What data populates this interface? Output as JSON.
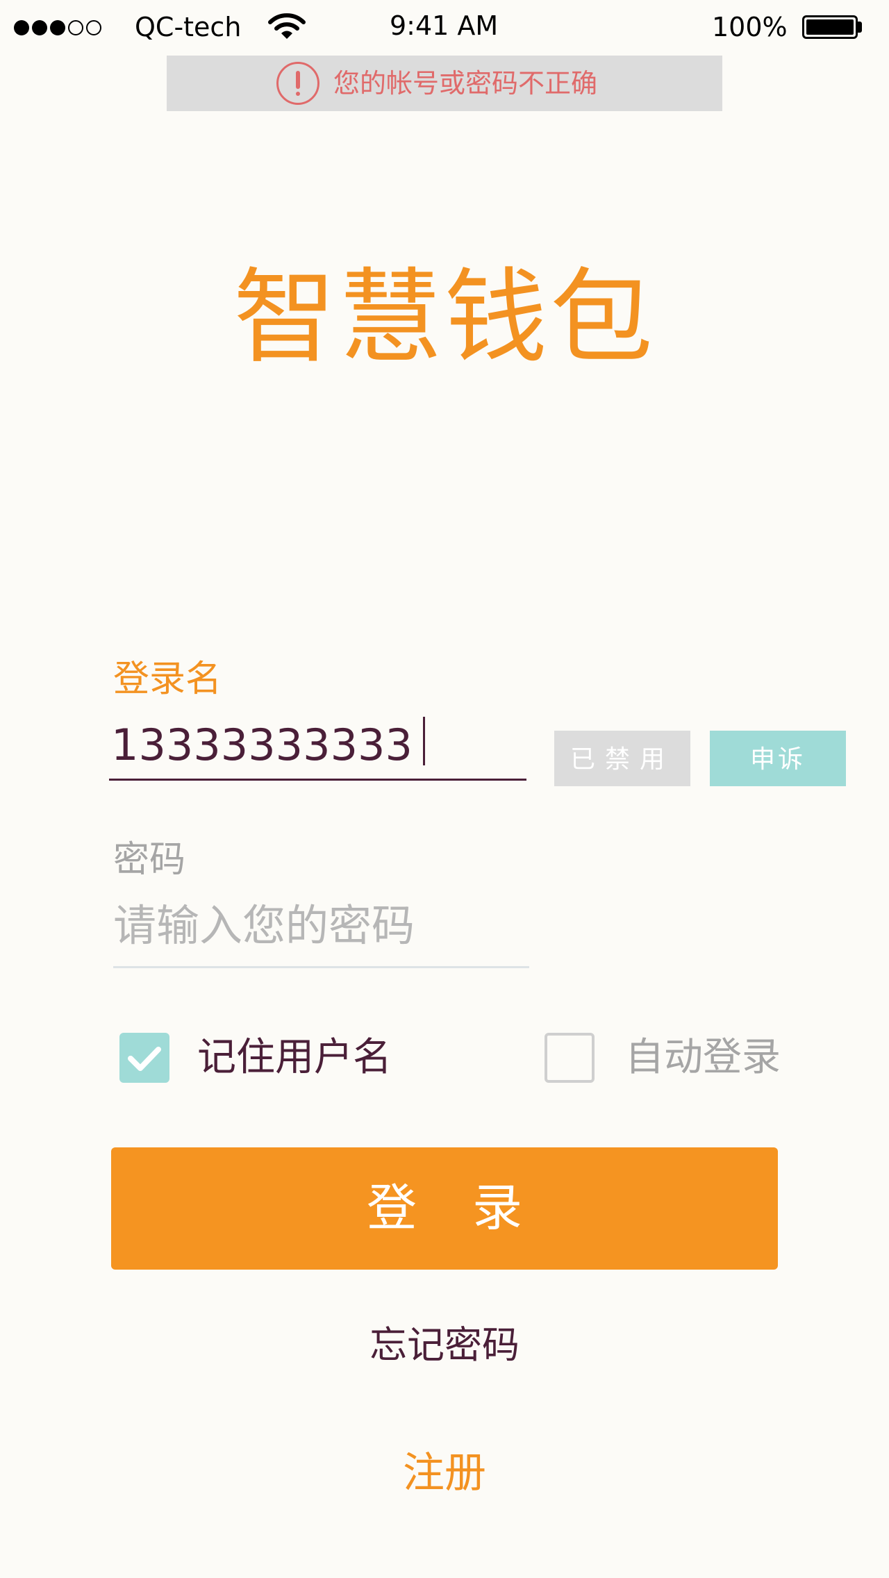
{
  "status_bar": {
    "carrier": "QC-tech",
    "time": "9:41 AM",
    "battery": "100%",
    "signal_bars": 3,
    "signal_total": 5
  },
  "toast": {
    "message": "您的帐号或密码不正确",
    "icon": "alert-circle-icon",
    "color": "#e06a6a"
  },
  "app": {
    "title": "智慧钱包",
    "accent_color": "#f39221"
  },
  "form": {
    "username_label": "登录名",
    "username_value": "13333333333",
    "disabled_badge": "已禁用",
    "appeal_button": "申诉",
    "password_label": "密码",
    "password_placeholder": "请输入您的密码",
    "remember_label": "记住用户名",
    "remember_checked": true,
    "auto_login_label": "自动登录",
    "auto_login_checked": false,
    "login_button": "登录",
    "forgot_password": "忘记密码",
    "register": "注册"
  }
}
